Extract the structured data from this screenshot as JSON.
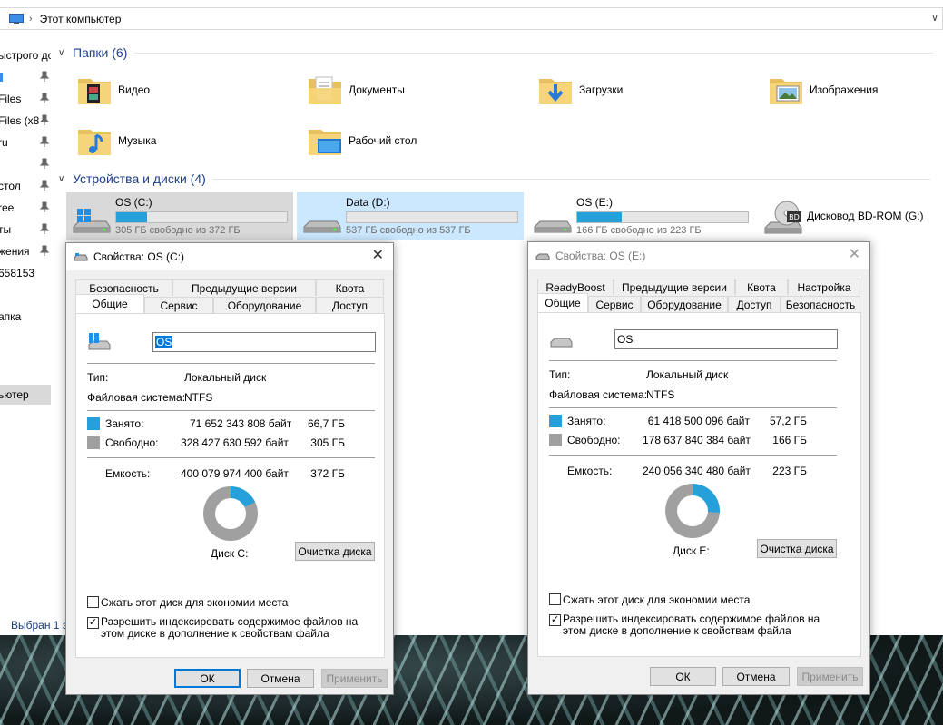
{
  "explorer": {
    "address": "Этот компьютер",
    "nav": [
      {
        "label": "ыстрого до",
        "pinned": false,
        "selected": false
      },
      {
        "label": "",
        "pinned": true,
        "selected": false,
        "blue": true
      },
      {
        "label": "Files",
        "pinned": true,
        "selected": false
      },
      {
        "label": "Files (x8",
        "pinned": true,
        "selected": false
      },
      {
        "label": "ru",
        "pinned": true,
        "selected": false
      },
      {
        "label": "",
        "pinned": true,
        "selected": false
      },
      {
        "label": "стол",
        "pinned": true,
        "selected": false
      },
      {
        "label": "ree",
        "pinned": true,
        "selected": false
      },
      {
        "label": "ты",
        "pinned": true,
        "selected": false
      },
      {
        "label": "жения",
        "pinned": true,
        "selected": false
      },
      {
        "label": "658153",
        "pinned": false,
        "selected": false
      },
      {
        "label": "апка",
        "pinned": false,
        "selected": false
      },
      {
        "label": "ьютер",
        "pinned": false,
        "selected": true
      }
    ],
    "status": "Выбран 1 э",
    "folders_header": "Папки (6)",
    "folders": [
      {
        "label": "Видео",
        "icon": "video-folder-icon"
      },
      {
        "label": "Документы",
        "icon": "documents-folder-icon"
      },
      {
        "label": "Загрузки",
        "icon": "downloads-folder-icon"
      },
      {
        "label": "Изображения",
        "icon": "pictures-folder-icon"
      },
      {
        "label": "Музыка",
        "icon": "music-folder-icon"
      },
      {
        "label": "Рабочий стол",
        "icon": "desktop-folder-icon"
      }
    ],
    "drives_header": "Устройства и диски (4)",
    "drives": [
      {
        "name": "OS (C:)",
        "free": "305 ГБ свободно из 372 ГБ",
        "used_fraction": 0.18
      },
      {
        "name": "Data (D:)",
        "free": "537 ГБ свободно из 537 ГБ",
        "used_fraction": 0.0
      },
      {
        "name": "OS (E:)",
        "free": "166 ГБ свободно из 223 ГБ",
        "used_fraction": 0.26
      },
      {
        "name": "Дисковод BD-ROM (G:)"
      }
    ]
  },
  "colors": {
    "used": "#26a0da",
    "free": "#a0a0a0",
    "accent": "#0078d7"
  },
  "dialog_c": {
    "title": "Свойства: OS (C:)",
    "tabs_top": [
      "Безопасность",
      "Предыдущие версии",
      "Квота"
    ],
    "tabs_bottom": [
      "Общие",
      "Сервис",
      "Оборудование",
      "Доступ"
    ],
    "name": "OS",
    "type_label": "Тип:",
    "type_value": "Локальный диск",
    "fs_label": "Файловая система:",
    "fs_value": "NTFS",
    "used_label": "Занято:",
    "used_bytes": "71 652 343 808 байт",
    "used_gb": "66,7 ГБ",
    "free_label": "Свободно:",
    "free_bytes": "328 427 630 592 байт",
    "free_gb": "305 ГБ",
    "cap_label": "Емкость:",
    "cap_bytes": "400 079 974 400 байт",
    "cap_gb": "372 ГБ",
    "used_fraction": 0.18,
    "disk_label": "Диск C:",
    "cleanup": "Очистка диска",
    "compress": "Сжать этот диск для экономии места",
    "compress_checked": false,
    "index": "Разрешить индексировать содержимое файлов на этом диске в дополнение к свойствам файла",
    "index_checked": true,
    "ok": "ОК",
    "cancel": "Отмена",
    "apply": "Применить"
  },
  "dialog_e": {
    "title": "Свойства: OS (E:)",
    "tabs_top": [
      "ReadyBoost",
      "Предыдущие версии",
      "Квота",
      "Настройка"
    ],
    "tabs_bottom": [
      "Общие",
      "Сервис",
      "Оборудование",
      "Доступ",
      "Безопасность"
    ],
    "name": "OS",
    "type_label": "Тип:",
    "type_value": "Локальный диск",
    "fs_label": "Файловая система:",
    "fs_value": "NTFS",
    "used_label": "Занято:",
    "used_bytes": "61 418 500 096 байт",
    "used_gb": "57,2 ГБ",
    "free_label": "Свободно:",
    "free_bytes": "178 637 840 384 байт",
    "free_gb": "166 ГБ",
    "cap_label": "Емкость:",
    "cap_bytes": "240 056 340 480 байт",
    "cap_gb": "223 ГБ",
    "used_fraction": 0.26,
    "disk_label": "Диск E:",
    "cleanup": "Очистка диска",
    "compress": "Сжать этот диск для экономии места",
    "compress_checked": false,
    "index": "Разрешить индексировать содержимое файлов на этом диске в дополнение к свойствам файла",
    "index_checked": true,
    "ok": "ОК",
    "cancel": "Отмена",
    "apply": "Применить"
  }
}
